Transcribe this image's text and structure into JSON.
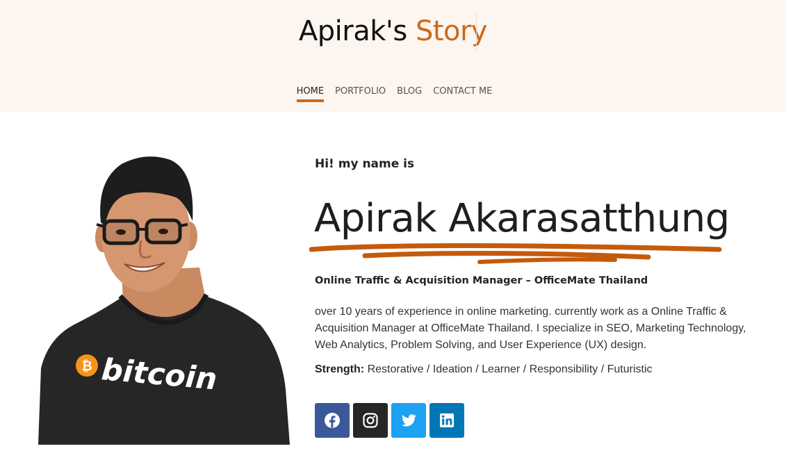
{
  "header": {
    "logo_part1": "Apirak's",
    "logo_part2": "Story",
    "nav": [
      {
        "label": "HOME",
        "active": true
      },
      {
        "label": "PORTFOLIO",
        "active": false
      },
      {
        "label": "BLOG",
        "active": false
      },
      {
        "label": "CONTACT ME",
        "active": false
      }
    ]
  },
  "hero": {
    "greeting": "Hi! my name is",
    "name": "Apirak Akarasatthung",
    "role": "Online Traffic & Acquisition Manager – OfficeMate Thailand",
    "bio": "over 10 years of experience in online marketing. currently work as a Online Traffic & Acquisition Manager at OfficeMate Thailand. I specialize in SEO, Marketing Technology, Web Analytics, Problem Solving, and User Experience (UX) design.",
    "strength_label": "Strength:",
    "strength_value": "Restorative / Ideation / Learner / Responsibility / Futuristic",
    "shirt_text": "bitcoin"
  },
  "social": [
    {
      "name": "facebook-icon",
      "color": "#3b5998"
    },
    {
      "name": "instagram-icon",
      "color": "#262626"
    },
    {
      "name": "twitter-icon",
      "color": "#1da1f2"
    },
    {
      "name": "linkedin-icon",
      "color": "#0077b5"
    }
  ],
  "colors": {
    "accent": "#cc6a1a",
    "header_bg": "#fdf5f0"
  }
}
